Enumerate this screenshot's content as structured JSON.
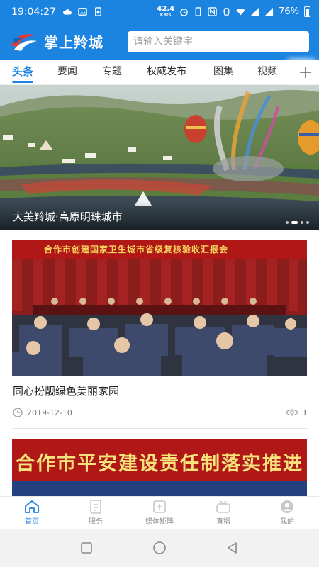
{
  "status_bar": {
    "time": "19:04:27",
    "net_speed_value": "42.4",
    "net_speed_unit": "KB/S",
    "battery": "76%"
  },
  "header": {
    "app_title": "掌上羚城",
    "search_placeholder": "请输入关键字"
  },
  "tabs": [
    {
      "label": "头条",
      "active": true
    },
    {
      "label": "要闻"
    },
    {
      "label": "专题"
    },
    {
      "label": "权威发布"
    },
    {
      "label": "图集"
    },
    {
      "label": "视频"
    }
  ],
  "banner": {
    "caption": "大美羚城·高原明珠城市",
    "slide_index": 1,
    "slide_count": 4
  },
  "feed": [
    {
      "image_banner_text": "合作市创建国家卫生城市省级复核验收汇报会",
      "title": "同心扮靓绿色美丽家园",
      "date": "2019-12-10",
      "views": "3"
    },
    {
      "image_banner_text": "合作市平安建设责任制落实推进"
    }
  ],
  "bottom_nav": [
    {
      "label": "首页",
      "icon": "home-icon",
      "active": true
    },
    {
      "label": "服务",
      "icon": "service-icon"
    },
    {
      "label": "媒体矩阵",
      "icon": "media-matrix-icon"
    },
    {
      "label": "直播",
      "icon": "live-icon"
    },
    {
      "label": "我的",
      "icon": "profile-icon"
    }
  ],
  "colors": {
    "brand_blue": "#1b83e0",
    "banner_red": "#b01717"
  }
}
